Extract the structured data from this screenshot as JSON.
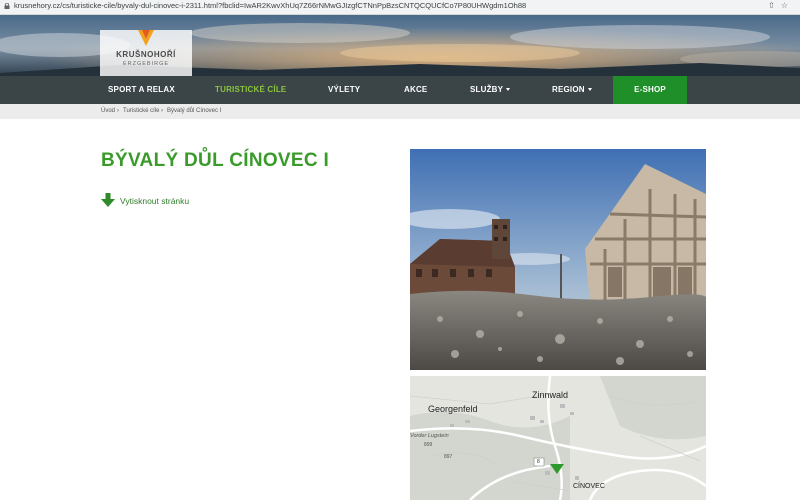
{
  "browser": {
    "url": "krusnehory.cz/cs/turisticke-cile/byvaly-dul-cinovec-i-2311.html?fbclid=IwAR2KwvXhUq7Z66rNMwGJIzgfCTNnPpBzsCNTQCQUCfCo7P80UHWgdm1Oh88"
  },
  "logo": {
    "title": "KRUŠNOHOŘÍ",
    "subtitle": "ERZGEBIRGE"
  },
  "nav": {
    "items": [
      {
        "label": "SPORT A RELAX"
      },
      {
        "label": "TURISTICKÉ CÍLE"
      },
      {
        "label": "VÝLETY"
      },
      {
        "label": "AKCE"
      },
      {
        "label": "SLUŽBY"
      },
      {
        "label": "REGION"
      },
      {
        "label": "E-SHOP"
      }
    ],
    "active": "TURISTICKÉ CÍLE"
  },
  "breadcrumb": {
    "items": [
      "Úvod",
      "Turistické cíle",
      "Bývalý důl Cínovec I"
    ],
    "separator": "›"
  },
  "page": {
    "title": "BÝVALÝ DŮL CÍNOVEC I",
    "print_label": "Vytisknout stránku"
  },
  "map": {
    "labels": [
      "Georgenfeld",
      "Zinnwald",
      "CÍNOVEC",
      "Vorder Lugstein",
      "899",
      "897",
      "8"
    ]
  },
  "colors": {
    "nav_bg": "#3b4547",
    "accent_green": "#3a9b2b",
    "active_nav": "#8cc43f",
    "eshop_bg": "#1f8f2a"
  }
}
